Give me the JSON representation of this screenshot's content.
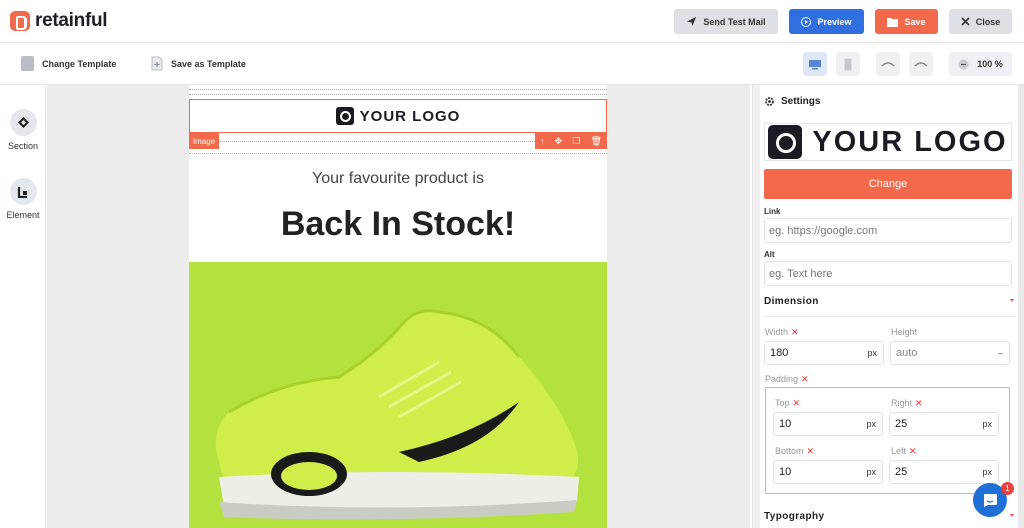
{
  "header": {
    "brand": "retainful",
    "buttons": {
      "send_test": "Send Test Mail",
      "preview": "Preview",
      "save": "Save",
      "close": "Close"
    }
  },
  "toolbar": {
    "change_template": "Change Template",
    "save_as_template": "Save as Template",
    "zoom": "100 %"
  },
  "left_nav": {
    "section": "Section",
    "element": "Element"
  },
  "email": {
    "logo_text": "YOUR LOGO",
    "image_tag": "Image",
    "subheading": "Your favourite product is",
    "heading": "Back In Stock!"
  },
  "settings": {
    "title": "Settings",
    "logo_text": "YOUR LOGO",
    "change_button": "Change",
    "link_label": "Link",
    "link_placeholder": "eg. https://google.com",
    "alt_label": "Alt",
    "alt_placeholder": "eg. Text here",
    "dimension_heading": "Dimension",
    "width_label": "Width",
    "width_value": "180",
    "width_unit": "px",
    "height_label": "Height",
    "height_value": "auto",
    "padding_label": "Padding",
    "top_label": "Top",
    "top_value": "10",
    "right_label": "Right",
    "right_value": "25",
    "bottom_label": "Bottom",
    "bottom_value": "10",
    "left_label": "Left",
    "left_value": "25",
    "unit": "px",
    "typography_heading": "Typography"
  },
  "chat": {
    "badge_count": "1"
  },
  "colors": {
    "accent": "#f26a4b",
    "preview_blue": "#2f6fe0",
    "hero_green": "#b3e23f"
  }
}
